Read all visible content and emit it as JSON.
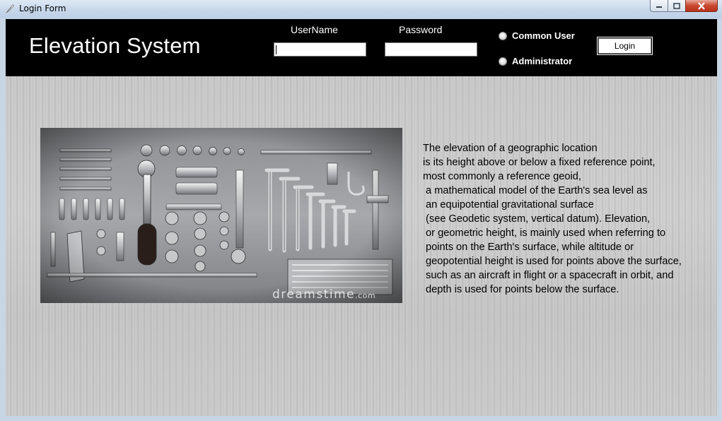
{
  "window": {
    "title": "Login Form",
    "icons": {
      "app": "feather-icon",
      "minimize": "minimize-icon",
      "maximize": "maximize-icon",
      "close": "close-icon"
    }
  },
  "header": {
    "app_title": "Elevation System",
    "username_label": "UserName",
    "username_value": "",
    "password_label": "Password",
    "password_value": "",
    "role_options": [
      "Common User",
      "Administrator"
    ],
    "login_label": "Login"
  },
  "content": {
    "image_watermark": "dreamstime",
    "image_watermark_suffix": ".com",
    "description_lines": [
      "The elevation of a geographic location",
      "is its height above or below a fixed reference point,",
      "most commonly a reference geoid,",
      " a mathematical model of the Earth's sea level as",
      " an equipotential gravitational surface",
      " (see Geodetic system, vertical datum). Elevation,",
      " or geometric height, is mainly used when referring to",
      " points on the Earth's surface, while altitude or",
      " geopotential height is used for points above the surface,",
      " such as an aircraft in flight or a spacecraft in orbit, and",
      " depth is used for points below the surface."
    ]
  },
  "colors": {
    "header_bg": "#000000",
    "header_text": "#ffffff",
    "close_button": "#c9472f"
  }
}
